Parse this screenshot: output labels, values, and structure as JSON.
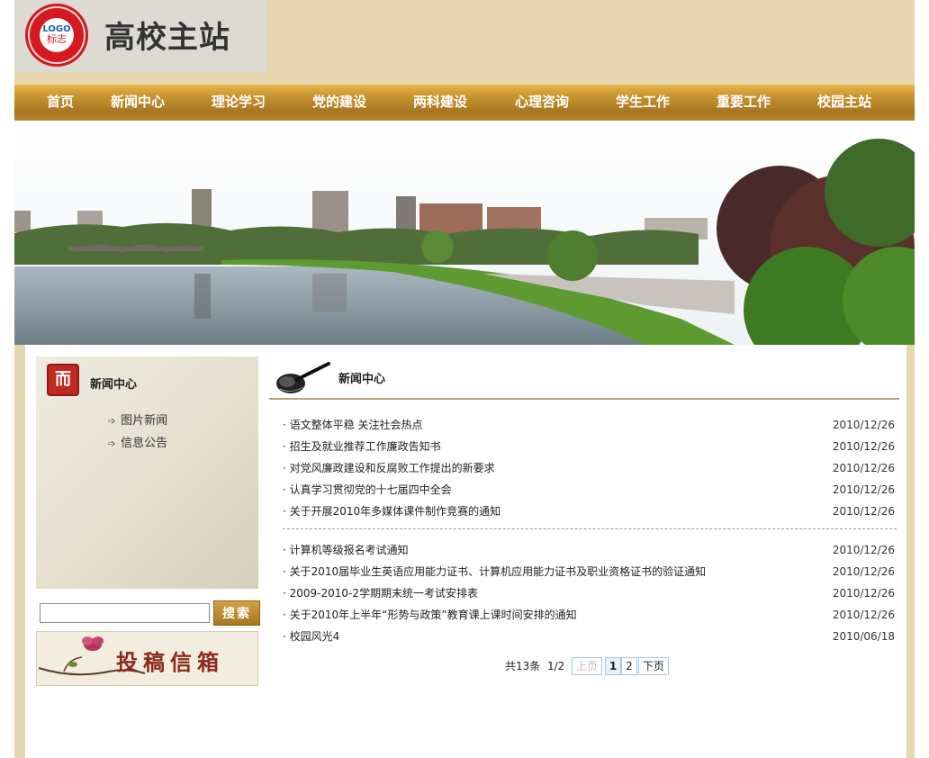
{
  "header": {
    "logo_text": "LOGO",
    "logo_sub": "标志",
    "site_title": "高校主站"
  },
  "nav": {
    "items": [
      "首页",
      "新闻中心",
      "理论学习",
      "党的建设",
      "两科建设",
      "心理咨询",
      "学生工作",
      "重要工作",
      "校园主站"
    ]
  },
  "sidebar": {
    "title": "新闻中心",
    "icon_glyph": "而",
    "links": [
      "图片新闻",
      "信息公告"
    ],
    "search_button": "搜索",
    "search_placeholder": "",
    "mailbox_label": "投稿信箱"
  },
  "main": {
    "title": "新闻中心",
    "group1": [
      {
        "title": "语文整体平稳 关注社会热点",
        "date": "2010/12/26"
      },
      {
        "title": "招生及就业推荐工作廉政告知书",
        "date": "2010/12/26"
      },
      {
        "title": "对党风廉政建设和反腐败工作提出的新要求",
        "date": "2010/12/26"
      },
      {
        "title": "认真学习贯彻党的十七届四中全会",
        "date": "2010/12/26"
      },
      {
        "title": "关于开展2010年多媒体课件制作竞赛的通知",
        "date": "2010/12/26"
      }
    ],
    "group2": [
      {
        "title": "计算机等级报名考试通知",
        "date": "2010/12/26"
      },
      {
        "title": "关于2010届毕业生英语应用能力证书、计算机应用能力证书及职业资格证书的验证通知",
        "date": "2010/12/26"
      },
      {
        "title": "2009-2010-2学期期末统一考试安排表",
        "date": "2010/12/26"
      },
      {
        "title": "关于2010年上半年“形势与政策”教育课上课时间安排的通知",
        "date": "2010/12/26"
      },
      {
        "title": "校园风光4",
        "date": "2010/06/18"
      }
    ],
    "pager": {
      "total": "共13条",
      "page_info": "1/2",
      "prev": "上页",
      "pages": [
        "1",
        "2"
      ],
      "next": "下页"
    }
  },
  "colors": {
    "page_bg": "#e6d7b0",
    "nav_gold": "#c99530",
    "accent_red": "#d21a1f"
  }
}
